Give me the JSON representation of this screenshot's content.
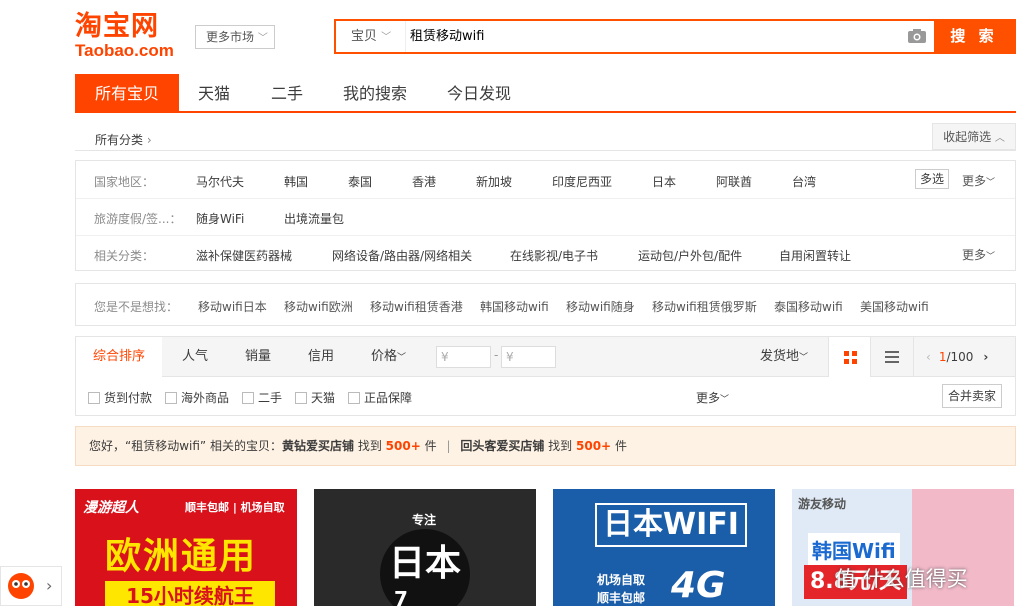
{
  "logo": {
    "cn": "淘宝网",
    "en": "Taobao.com"
  },
  "market": {
    "label": "更多市场"
  },
  "search": {
    "scope": "宝贝",
    "query": "租赁移动wifi",
    "button": "搜 索"
  },
  "tabs": [
    "所有宝贝",
    "天猫",
    "二手",
    "我的搜索",
    "今日发现"
  ],
  "breadcrumb": {
    "all": "所有分类",
    "collapse": "收起筛选"
  },
  "filters": {
    "region": {
      "label": "国家地区：",
      "items": [
        "马尔代夫",
        "韩国",
        "泰国",
        "香港",
        "新加坡",
        "印度尼西亚",
        "日本",
        "阿联酋",
        "台湾"
      ],
      "multi": "多选",
      "more": "更多"
    },
    "travel": {
      "label": "旅游度假/签...：",
      "items": [
        "随身WiFi",
        "出境流量包"
      ]
    },
    "related": {
      "label": "相关分类：",
      "items": [
        "滋补保健医药器械",
        "网络设备/路由器/网络相关",
        "在线影视/电子书",
        "运动包/户外包/配件",
        "自用闲置转让"
      ],
      "more": "更多"
    }
  },
  "suggest": {
    "label": "您是不是想找：",
    "items": [
      "移动wifi日本",
      "移动wifi欧洲",
      "移动wifi租赁香港",
      "韩国移动wifi",
      "移动wifi随身",
      "移动wifi租赁俄罗斯",
      "泰国移动wifi",
      "美国移动wifi"
    ]
  },
  "sort": {
    "items": [
      "综合排序",
      "人气",
      "销量",
      "信用",
      "价格"
    ],
    "price_from": "¥",
    "price_to": "¥",
    "dash": "-",
    "ship_from": "发货地",
    "page_current": "1",
    "page_total": "/100"
  },
  "checks": {
    "items": [
      "货到付款",
      "海外商品",
      "二手",
      "天猫",
      "正品保障"
    ],
    "more": "更多",
    "merge": "合并卖家"
  },
  "notice": {
    "prefix": "您好，“租赁移动wifi” 相关的宝贝：",
    "shop1": "黄钻爱买店铺",
    "found": "找到",
    "count1": "500+",
    "unit": "件",
    "divider": "|",
    "shop2": "回头客爱买店铺",
    "count2": "500+"
  },
  "products": [
    {
      "brand": "漫游超人",
      "tag": "顺丰包邮 | 机场自取",
      "headline": "欧洲通用",
      "sub": "15小时续航王"
    },
    {
      "tag": "专注",
      "headline": "日本",
      "sub": "7"
    },
    {
      "headline": "日本WIFI",
      "tag": "机场自取",
      "sub": "顺丰包邮",
      "badge": "4G"
    },
    {
      "brand": "游友移动",
      "headline": "韩国Wifi",
      "sub": "8.8元/天"
    }
  ],
  "watermark": "值 什么值得买",
  "colors": {
    "accent": "#ff4400",
    "search_button": "#ff5000"
  }
}
